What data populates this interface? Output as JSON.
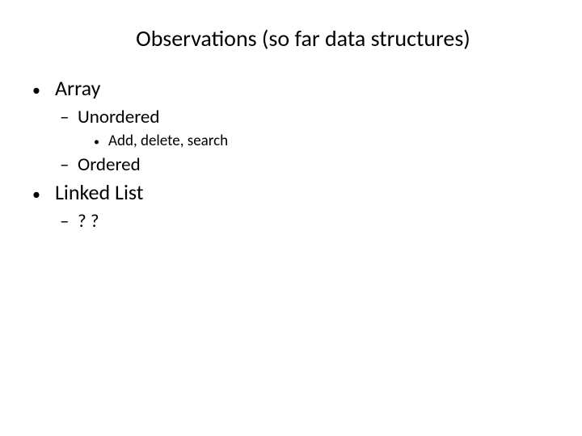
{
  "slide": {
    "title": "Observations (so far data structures)",
    "item1": "Array",
    "item1_sub1": "Unordered",
    "item1_sub1_sub1": "Add, delete, search",
    "item1_sub2": "Ordered",
    "item2": "Linked List",
    "item2_sub1": "? ?"
  }
}
